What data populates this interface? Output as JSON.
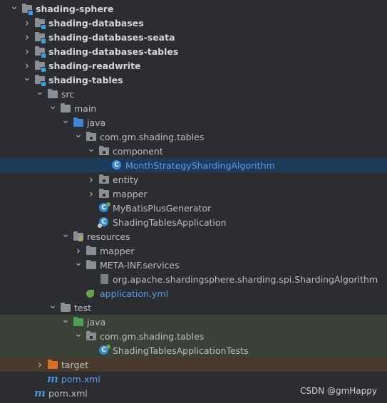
{
  "rows": [
    {
      "label": "shading-sphere",
      "depth": 0,
      "arrow": "down",
      "icon": "module-folder-icon",
      "bold": true
    },
    {
      "label": "shading-databases",
      "depth": 1,
      "arrow": "right",
      "icon": "module-folder-icon",
      "bold": true
    },
    {
      "label": "shading-databases-seata",
      "depth": 1,
      "arrow": "right",
      "icon": "module-folder-icon",
      "bold": true
    },
    {
      "label": "shading-databases-tables",
      "depth": 1,
      "arrow": "right",
      "icon": "module-folder-icon",
      "bold": true
    },
    {
      "label": "shading-readwrite",
      "depth": 1,
      "arrow": "right",
      "icon": "module-folder-icon",
      "bold": true
    },
    {
      "label": "shading-tables",
      "depth": 1,
      "arrow": "down",
      "icon": "module-folder-icon",
      "bold": true
    },
    {
      "label": "src",
      "depth": 2,
      "arrow": "down",
      "icon": "folder-icon"
    },
    {
      "label": "main",
      "depth": 3,
      "arrow": "down",
      "icon": "folder-icon"
    },
    {
      "label": "java",
      "depth": 4,
      "arrow": "down",
      "icon": "source-folder-icon"
    },
    {
      "label": "com.gm.shading.tables",
      "depth": 5,
      "arrow": "down",
      "icon": "package-icon"
    },
    {
      "label": "component",
      "depth": 6,
      "arrow": "down",
      "icon": "package-icon"
    },
    {
      "label": "MonthStrategyShardingAlgorithm",
      "depth": 7,
      "arrow": "",
      "icon": "class-icon",
      "selected": true,
      "blue": true
    },
    {
      "label": "entity",
      "depth": 6,
      "arrow": "right",
      "icon": "package-icon"
    },
    {
      "label": "mapper",
      "depth": 6,
      "arrow": "right",
      "icon": "package-icon"
    },
    {
      "label": "MyBatisPlusGenerator",
      "depth": 6,
      "arrow": "",
      "icon": "runnable-class-icon"
    },
    {
      "label": "ShadingTablesApplication",
      "depth": 6,
      "arrow": "",
      "icon": "spring-boot-class-icon"
    },
    {
      "label": "resources",
      "depth": 4,
      "arrow": "down",
      "icon": "resources-folder-icon"
    },
    {
      "label": "mapper",
      "depth": 5,
      "arrow": "right",
      "icon": "folder-icon"
    },
    {
      "label": "META-INF.services",
      "depth": 5,
      "arrow": "down",
      "icon": "folder-icon"
    },
    {
      "label": "org.apache.shardingsphere.sharding.spi.ShardingAlgorithm",
      "depth": 6,
      "arrow": "",
      "icon": "file-icon"
    },
    {
      "label": "application.yml",
      "depth": 5,
      "arrow": "",
      "icon": "yaml-icon",
      "blue": true
    },
    {
      "label": "test",
      "depth": 3,
      "arrow": "down",
      "icon": "folder-icon"
    },
    {
      "label": "java",
      "depth": 4,
      "arrow": "down",
      "icon": "test-folder-icon",
      "test": true
    },
    {
      "label": "com.gm.shading.tables",
      "depth": 5,
      "arrow": "down",
      "icon": "package-icon",
      "test": true
    },
    {
      "label": "ShadingTablesApplicationTests",
      "depth": 6,
      "arrow": "",
      "icon": "test-class-icon",
      "test": true
    },
    {
      "label": "target",
      "depth": 2,
      "arrow": "right",
      "icon": "excluded-folder-icon",
      "excluded": true
    },
    {
      "label": "pom.xml",
      "depth": 2,
      "arrow": "",
      "icon": "maven-icon",
      "blue": true
    },
    {
      "label": "pom.xml",
      "depth": 1,
      "arrow": "",
      "icon": "maven-icon"
    }
  ],
  "watermark": "CSDN @gmHappy"
}
